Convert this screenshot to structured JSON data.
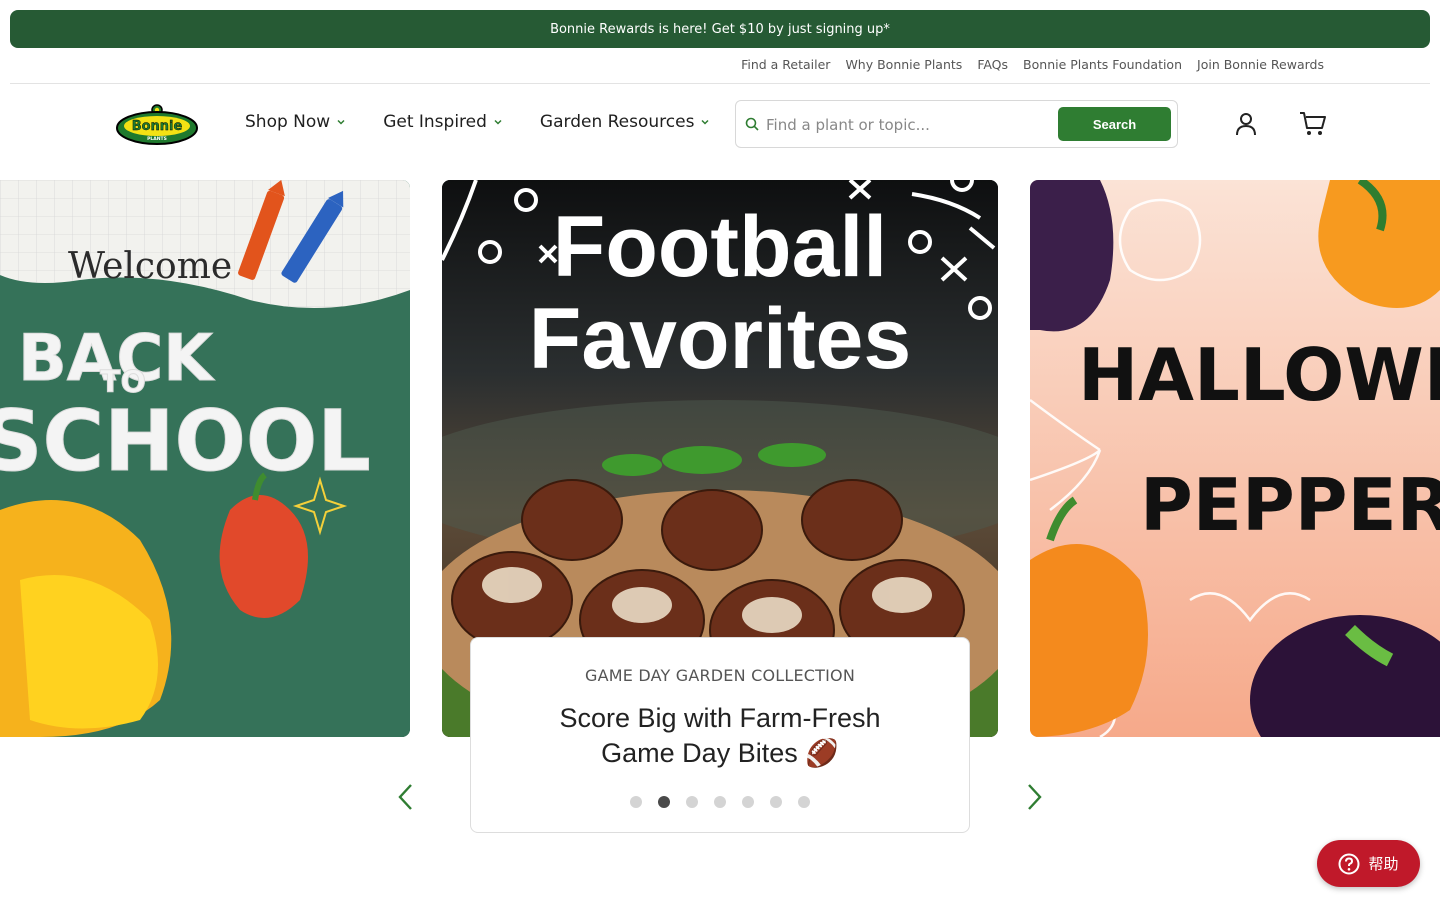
{
  "promo": {
    "text": "Bonnie Rewards is here! Get $10 by just signing up*"
  },
  "utility_links": [
    "Find a Retailer",
    "Why Bonnie Plants",
    "FAQs",
    "Bonnie Plants Foundation",
    "Join Bonnie Rewards"
  ],
  "header": {
    "logo": {
      "word": "Bonnie",
      "sub": "PLANTS"
    },
    "nav": [
      {
        "label": "Shop Now"
      },
      {
        "label": "Get Inspired"
      },
      {
        "label": "Garden Resources"
      }
    ],
    "search": {
      "placeholder": "Find a plant or topic...",
      "button_label": "Search"
    },
    "icons": [
      "account-icon",
      "cart-icon"
    ]
  },
  "carousel": {
    "slides": [
      {
        "id": "back-to-school",
        "text_lines": [
          "Welcome",
          "BACK",
          "TO",
          "SCHOOL"
        ]
      },
      {
        "id": "football-favorites",
        "text_lines": [
          "Football",
          "Favorites"
        ]
      },
      {
        "id": "halloween-peppers",
        "text_lines": [
          "HALLOWEEN",
          "PEPPERS"
        ]
      }
    ],
    "active_card": {
      "eyebrow": "GAME DAY GARDEN COLLECTION",
      "headline": "Score Big with Farm-Fresh Game Day Bites 🏈"
    },
    "dot_count": 7,
    "active_dot": 2
  },
  "help_button": {
    "label": "帮助"
  },
  "colors": {
    "brand_green": "#265a34",
    "button_green": "#2f7d32",
    "help_red": "#c0192a"
  }
}
